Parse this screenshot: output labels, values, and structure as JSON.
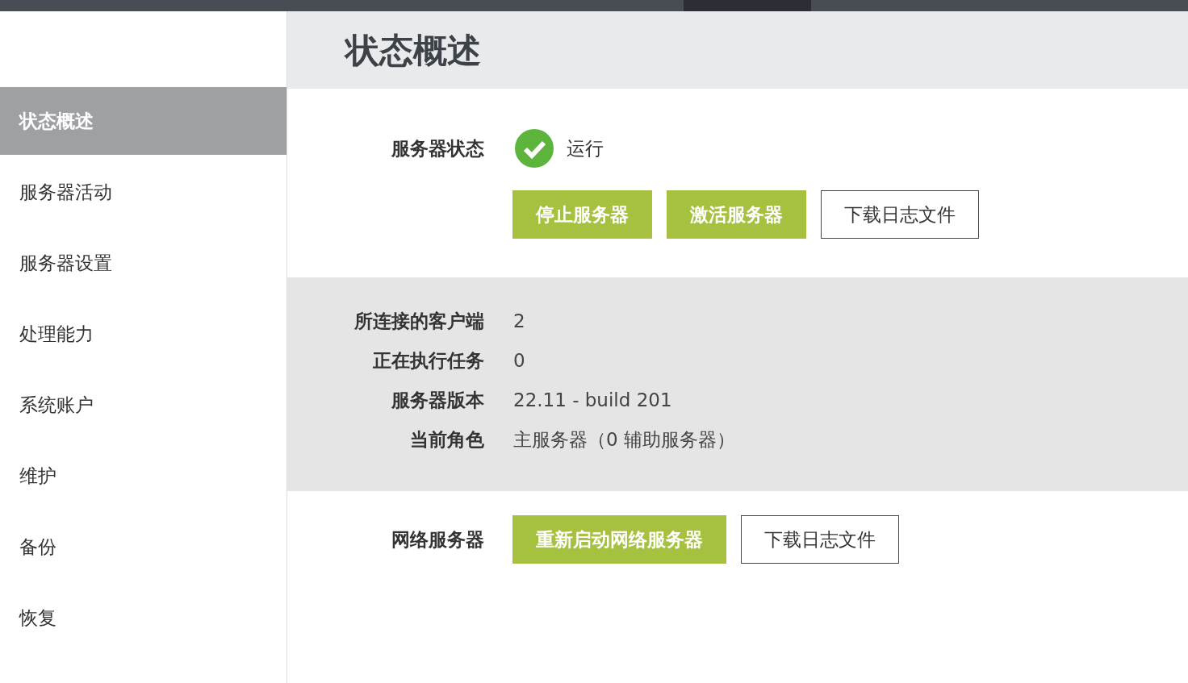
{
  "sidebar": {
    "items": [
      {
        "label": "状态概述",
        "selected": true
      },
      {
        "label": "服务器活动",
        "selected": false
      },
      {
        "label": "服务器设置",
        "selected": false
      },
      {
        "label": "处理能力",
        "selected": false
      },
      {
        "label": "系统账户",
        "selected": false
      },
      {
        "label": "维护",
        "selected": false
      },
      {
        "label": "备份",
        "selected": false
      },
      {
        "label": "恢复",
        "selected": false
      }
    ]
  },
  "header": {
    "title": "状态概述"
  },
  "server_status": {
    "label": "服务器状态",
    "status": "运行",
    "running": true,
    "buttons": [
      {
        "label": "停止服务器",
        "kind": "primary"
      },
      {
        "label": "激活服务器",
        "kind": "primary"
      },
      {
        "label": "下载日志文件",
        "kind": "outline"
      }
    ]
  },
  "info": [
    {
      "label": "所连接的客户端",
      "value": "2"
    },
    {
      "label": "正在执行任务",
      "value": "0"
    },
    {
      "label": "服务器版本",
      "value": "22.11 - build 201"
    },
    {
      "label": "当前角色",
      "value": "主服务器（0 辅助服务器）"
    }
  ],
  "web_server": {
    "label": "网络服务器",
    "buttons": [
      {
        "label": "重新启动网络服务器",
        "kind": "primary"
      },
      {
        "label": "下载日志文件",
        "kind": "outline"
      }
    ]
  }
}
